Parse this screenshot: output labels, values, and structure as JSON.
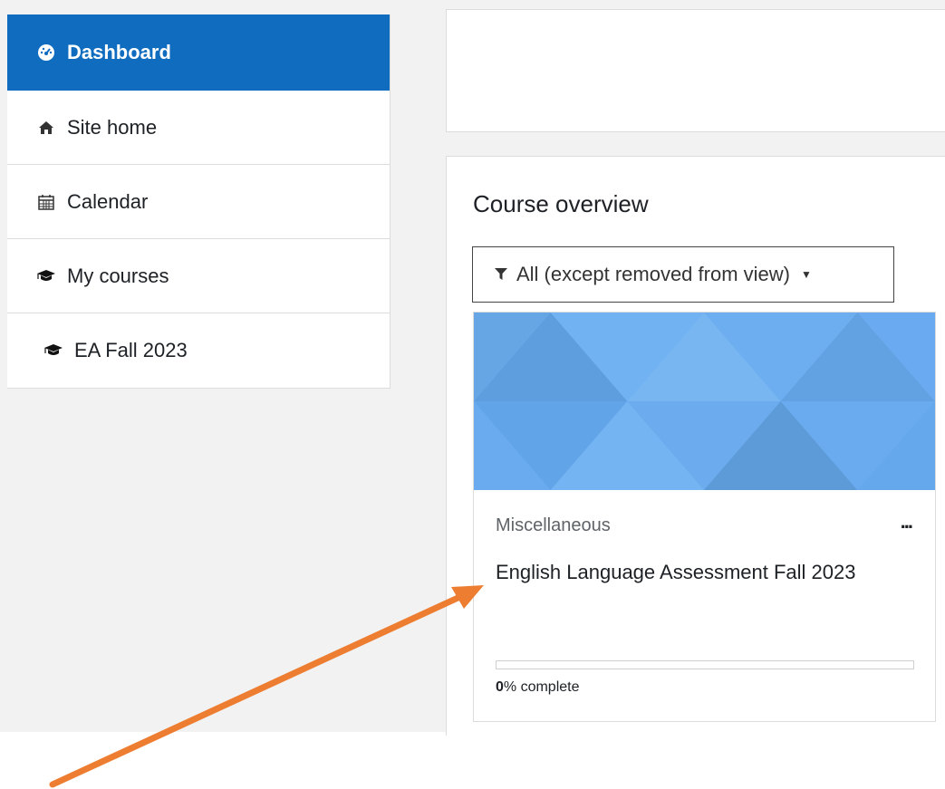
{
  "sidebar": {
    "items": [
      {
        "label": "Dashboard",
        "icon": "tachometer-icon",
        "active": true
      },
      {
        "label": "Site home",
        "icon": "home-icon",
        "active": false
      },
      {
        "label": "Calendar",
        "icon": "calendar-icon",
        "active": false
      },
      {
        "label": "My courses",
        "icon": "graduation-cap-icon",
        "active": false
      },
      {
        "label": "EA Fall 2023",
        "icon": "graduation-cap-icon",
        "active": false
      }
    ]
  },
  "course_overview": {
    "title": "Course overview",
    "filter_label": "All (except removed from view)",
    "course": {
      "category": "Miscellaneous",
      "name": "English Language Assessment Fall 2023",
      "progress_percent": "0",
      "progress_suffix": "% complete",
      "menu_label": "..."
    }
  },
  "colors": {
    "accent": "#0f6cbf",
    "annotation_arrow": "#ed7d31",
    "card_image": "#6aaef0"
  }
}
